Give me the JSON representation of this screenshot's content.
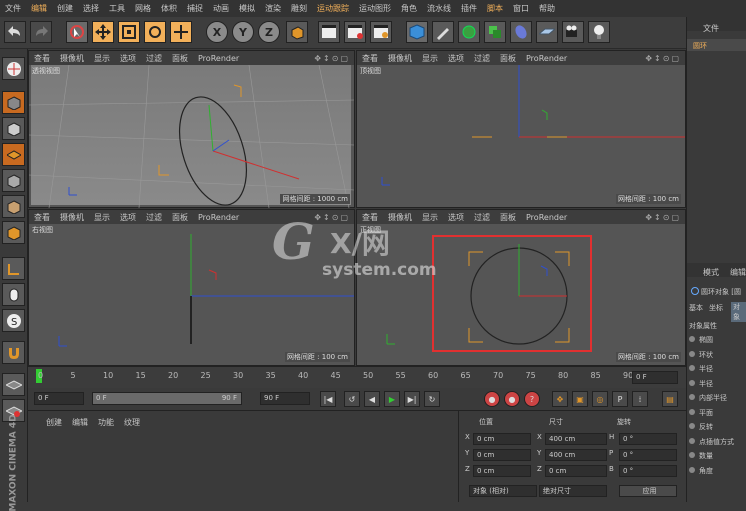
{
  "menu": [
    "文件",
    "编辑",
    "创建",
    "选择",
    "工具",
    "网格",
    "体积",
    "捕捉",
    "动画",
    "模拟",
    "渲染",
    "雕刻",
    "运动跟踪",
    "运动图形",
    "角色",
    "流水线",
    "插件",
    "脚本",
    "窗口",
    "帮助"
  ],
  "toolbar": {
    "x": "X",
    "y": "Y",
    "z": "Z"
  },
  "viewports": [
    {
      "title": "透视视图",
      "tabs": [
        "查看",
        "摄像机",
        "显示",
        "选项",
        "过滤",
        "面板",
        "ProRender"
      ],
      "grid": "网格间距 : 1000 cm"
    },
    {
      "title": "顶视图",
      "tabs": [
        "查看",
        "摄像机",
        "显示",
        "选项",
        "过滤",
        "面板",
        "ProRender"
      ],
      "grid": "网格间距 : 100 cm"
    },
    {
      "title": "右视图",
      "tabs": [
        "查看",
        "摄像机",
        "显示",
        "选项",
        "过滤",
        "面板",
        "ProRender"
      ],
      "grid": "网格间距 : 100 cm"
    },
    {
      "title": "正视图",
      "tabs": [
        "查看",
        "摄像机",
        "显示",
        "选项",
        "过滤",
        "面板",
        "ProRender"
      ],
      "grid": "网格间距 : 100 cm"
    }
  ],
  "timeline": {
    "ticks": [
      "0",
      "5",
      "10",
      "15",
      "20",
      "25",
      "30",
      "35",
      "40",
      "45",
      "50",
      "55",
      "60",
      "65",
      "70",
      "75",
      "80",
      "85",
      "90"
    ],
    "frame": "0 F"
  },
  "transport": {
    "start": "0 F",
    "range_start": "0 F",
    "range_end": "90 F",
    "end": "90 F"
  },
  "bottom_tabs": [
    "创建",
    "编辑",
    "功能",
    "纹理"
  ],
  "coords": {
    "headers": [
      "位置",
      "尺寸",
      "旋转"
    ],
    "rows": [
      {
        "axis": "X",
        "pos": "0 cm",
        "size_axis": "X",
        "size": "400 cm",
        "rot_axis": "H",
        "rot": "0 °"
      },
      {
        "axis": "Y",
        "pos": "0 cm",
        "size_axis": "Y",
        "size": "400 cm",
        "rot_axis": "P",
        "rot": "0 °"
      },
      {
        "axis": "Z",
        "pos": "0 cm",
        "size_axis": "Z",
        "size": "0 cm",
        "rot_axis": "B",
        "rot": "0 °"
      }
    ],
    "mode_a": "对象 (相对)",
    "mode_b": "绝对尺寸",
    "apply": "应用"
  },
  "right_panel": {
    "top_tab": "文件",
    "object": "圆环",
    "mode_tabs": [
      "模式",
      "编辑"
    ],
    "object_title": "圆环对象 [圆",
    "attr_tabs": [
      "基本",
      "坐标",
      "对象"
    ],
    "section": "对象属性",
    "props": [
      "椭圆",
      "环状",
      "半径",
      "半径",
      "内部半径",
      "平面",
      "反转",
      "点插值方式",
      "数量",
      "角度"
    ]
  },
  "watermark": {
    "logo": "G",
    "cn": "X/网",
    "site": "system.com"
  },
  "brand": "MAXON CINEMA 4D",
  "colors": {
    "accent": "#f2b05a",
    "highlight_box": "#e23030",
    "axis_x": "#d03030",
    "axis_y": "#30b030",
    "axis_z": "#3050d0",
    "bounds": "#e0962a"
  }
}
